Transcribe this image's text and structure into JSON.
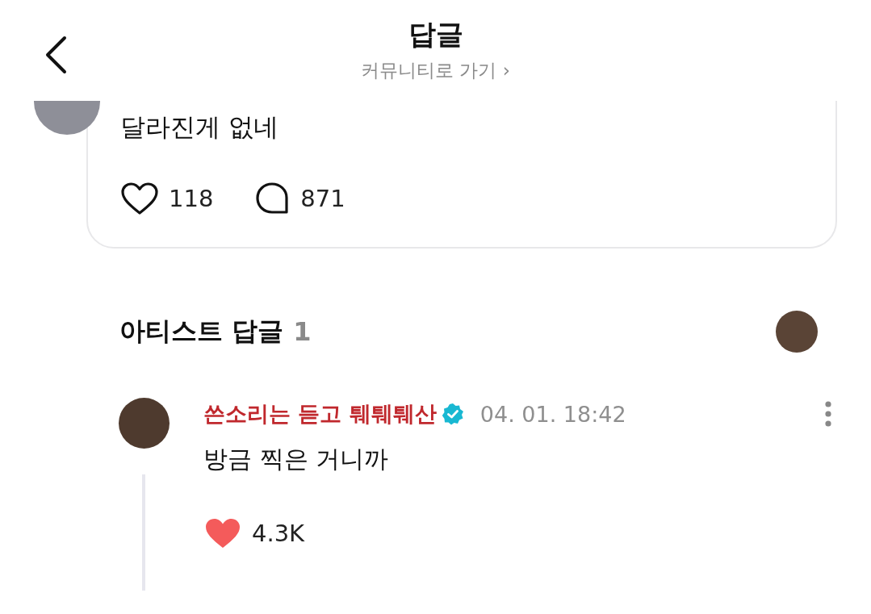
{
  "header": {
    "title": "답글",
    "subtitle": "커뮤니티로 가기",
    "subtitle_chevron": "›"
  },
  "post": {
    "text": "달라진게 없네",
    "likes": "118",
    "liked": false,
    "comments": "871"
  },
  "artist_replies": {
    "heading": "아티스트 답글",
    "count": "1"
  },
  "reply": {
    "author": "쓴소리는 듣고 퉤퉤퉤산",
    "verified": true,
    "time": "04. 01. 18:42",
    "text": "방금 찍은 거니까",
    "likes": "4.3K",
    "liked": true
  }
}
